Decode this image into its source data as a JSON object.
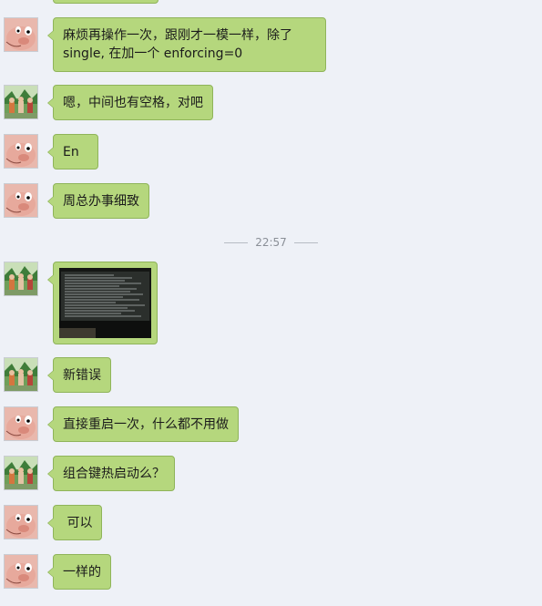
{
  "colors": {
    "background": "#eef1f7",
    "bubble": "#b5d77d",
    "bubble_border": "#8fb45a",
    "timestamp": "#8a8f97"
  },
  "messages": [
    {
      "sender": "pig",
      "avatar_icon": "pig-avatar-icon",
      "lines": [
        "麻烦再操作一次，跟刚才一模一样，除了",
        "single, 在加一个 enforcing=0"
      ]
    },
    {
      "sender": "photo",
      "avatar_icon": "photo-avatar-icon",
      "lines": [
        "嗯，中间也有空格，对吧"
      ]
    },
    {
      "sender": "pig",
      "avatar_icon": "pig-avatar-icon",
      "lines": [
        "En"
      ]
    },
    {
      "sender": "pig",
      "avatar_icon": "pig-avatar-icon",
      "lines": [
        "周总办事细致"
      ]
    },
    {
      "sender": "photo",
      "avatar_icon": "photo-avatar-icon",
      "image": "terminal-screen-photo"
    },
    {
      "sender": "photo",
      "avatar_icon": "photo-avatar-icon",
      "lines": [
        "新错误"
      ]
    },
    {
      "sender": "pig",
      "avatar_icon": "pig-avatar-icon",
      "lines": [
        "直接重启一次，什么都不用做"
      ]
    },
    {
      "sender": "photo",
      "avatar_icon": "photo-avatar-icon",
      "lines": [
        "组合键热启动么？"
      ]
    },
    {
      "sender": "pig",
      "avatar_icon": "pig-avatar-icon",
      "lines": [
        " 可以"
      ]
    },
    {
      "sender": "pig",
      "avatar_icon": "pig-avatar-icon",
      "lines": [
        "一样的"
      ]
    }
  ],
  "timestamp": "22:57"
}
